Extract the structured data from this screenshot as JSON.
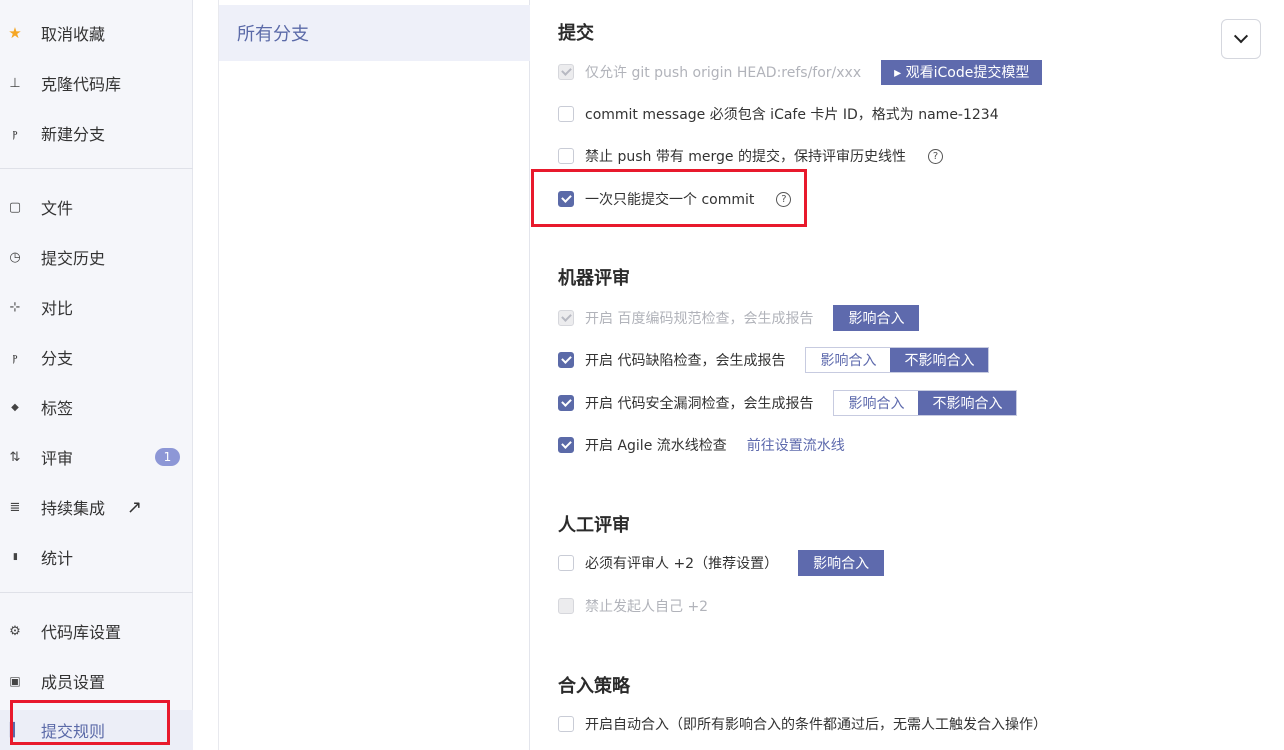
{
  "sidebar": {
    "groups": [
      [
        {
          "icon": "star-icon",
          "glyph": "★",
          "label": "取消收藏"
        },
        {
          "icon": "download-icon",
          "glyph": "⊥",
          "label": "克隆代码库"
        },
        {
          "icon": "new-branch-icon",
          "glyph": "ⲣ",
          "label": "新建分支"
        }
      ],
      [
        {
          "icon": "file-icon",
          "glyph": "▢",
          "label": "文件"
        },
        {
          "icon": "history-icon",
          "glyph": "◷",
          "label": "提交历史"
        },
        {
          "icon": "compare-icon",
          "glyph": "⊹",
          "label": "对比"
        },
        {
          "icon": "branch-icon",
          "glyph": "ⲣ",
          "label": "分支"
        },
        {
          "icon": "tag-icon",
          "glyph": "◆",
          "label": "标签"
        },
        {
          "icon": "review-icon",
          "glyph": "⇅",
          "label": "评审",
          "badge": "1"
        },
        {
          "icon": "ci-icon",
          "glyph": "≣",
          "label": "持续集成",
          "external": "↗"
        },
        {
          "icon": "stats-icon",
          "glyph": "▮",
          "label": "统计"
        }
      ],
      [
        {
          "icon": "gear-icon",
          "glyph": "⚙",
          "label": "代码库设置"
        },
        {
          "icon": "lock-icon",
          "glyph": "▣",
          "label": "成员设置"
        },
        {
          "icon": "rules-icon",
          "glyph": "▌",
          "label": "提交规则",
          "active": true
        }
      ]
    ]
  },
  "branches": {
    "selected": "所有分支"
  },
  "sections": {
    "commit": {
      "title": "提交",
      "rows": [
        {
          "text": "仅允许 git push origin HEAD:refs/for/xxx",
          "checked": true,
          "disabled": true,
          "button": "▸ 观看iCode提交模型"
        },
        {
          "text": "commit message 必须包含 iCafe 卡片 ID，格式为 name-1234",
          "checked": false
        },
        {
          "text": "禁止 push 带有 merge 的提交，保持评审历史线性",
          "checked": false,
          "help": "?"
        },
        {
          "text": "一次只能提交一个 commit",
          "checked": true,
          "help": "?"
        }
      ]
    },
    "machine": {
      "title": "机器评审",
      "rows": [
        {
          "text": "开启 百度编码规范检查，会生成报告",
          "checked": true,
          "disabled": true,
          "button": "影响合入"
        },
        {
          "text": "开启 代码缺陷检查，会生成报告",
          "checked": true,
          "options": [
            "影响合入",
            "不影响合入"
          ]
        },
        {
          "text": "开启 代码安全漏洞检查，会生成报告",
          "checked": true,
          "options": [
            "影响合入",
            "不影响合入"
          ]
        },
        {
          "text": "开启 Agile 流水线检查",
          "checked": true,
          "link": "前往设置流水线"
        }
      ]
    },
    "manual": {
      "title": "人工评审",
      "rows": [
        {
          "text": "必须有评审人 +2（推荐设置）",
          "checked": false,
          "button": "影响合入"
        },
        {
          "text": "禁止发起人自己 +2",
          "checked": false,
          "disabled": true
        }
      ]
    },
    "merge": {
      "title": "合入策略",
      "rows": [
        {
          "text": "开启自动合入（即所有影响合入的条件都通过后，无需人工触发合入操作）",
          "checked": false
        }
      ]
    }
  },
  "colors": {
    "accent": "#5e6aad",
    "highlight": "#e8192c",
    "star": "#f5a623"
  }
}
